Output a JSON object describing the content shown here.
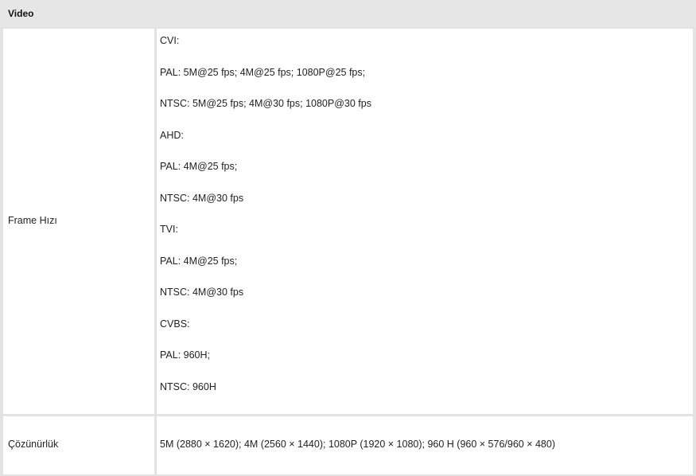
{
  "section": {
    "title": "Video"
  },
  "rows": [
    {
      "label": "Frame Hızı",
      "lines": [
        "CVI:",
        "PAL: 5M@25 fps; 4M@25 fps; 1080P@25 fps;",
        "NTSC: 5M@25 fps; 4M@30 fps; 1080P@30 fps",
        "AHD:",
        "PAL: 4M@25 fps;",
        "NTSC: 4M@30 fps",
        "TVI:",
        "PAL: 4M@25 fps;",
        "NTSC: 4M@30 fps",
        "CVBS:",
        "PAL: 960H;",
        "NTSC: 960H"
      ]
    },
    {
      "label": "Çözünürlük",
      "value": "5M (2880 × 1620); 4M (2560 × 1440); 1080P (1920 × 1080); 960 H (960 × 576/960 × 480)"
    }
  ],
  "colors": {
    "header_bg": "#e6e6e6",
    "border": "#e3e3e3",
    "cell_bg": "#ffffff",
    "text": "#222222"
  }
}
